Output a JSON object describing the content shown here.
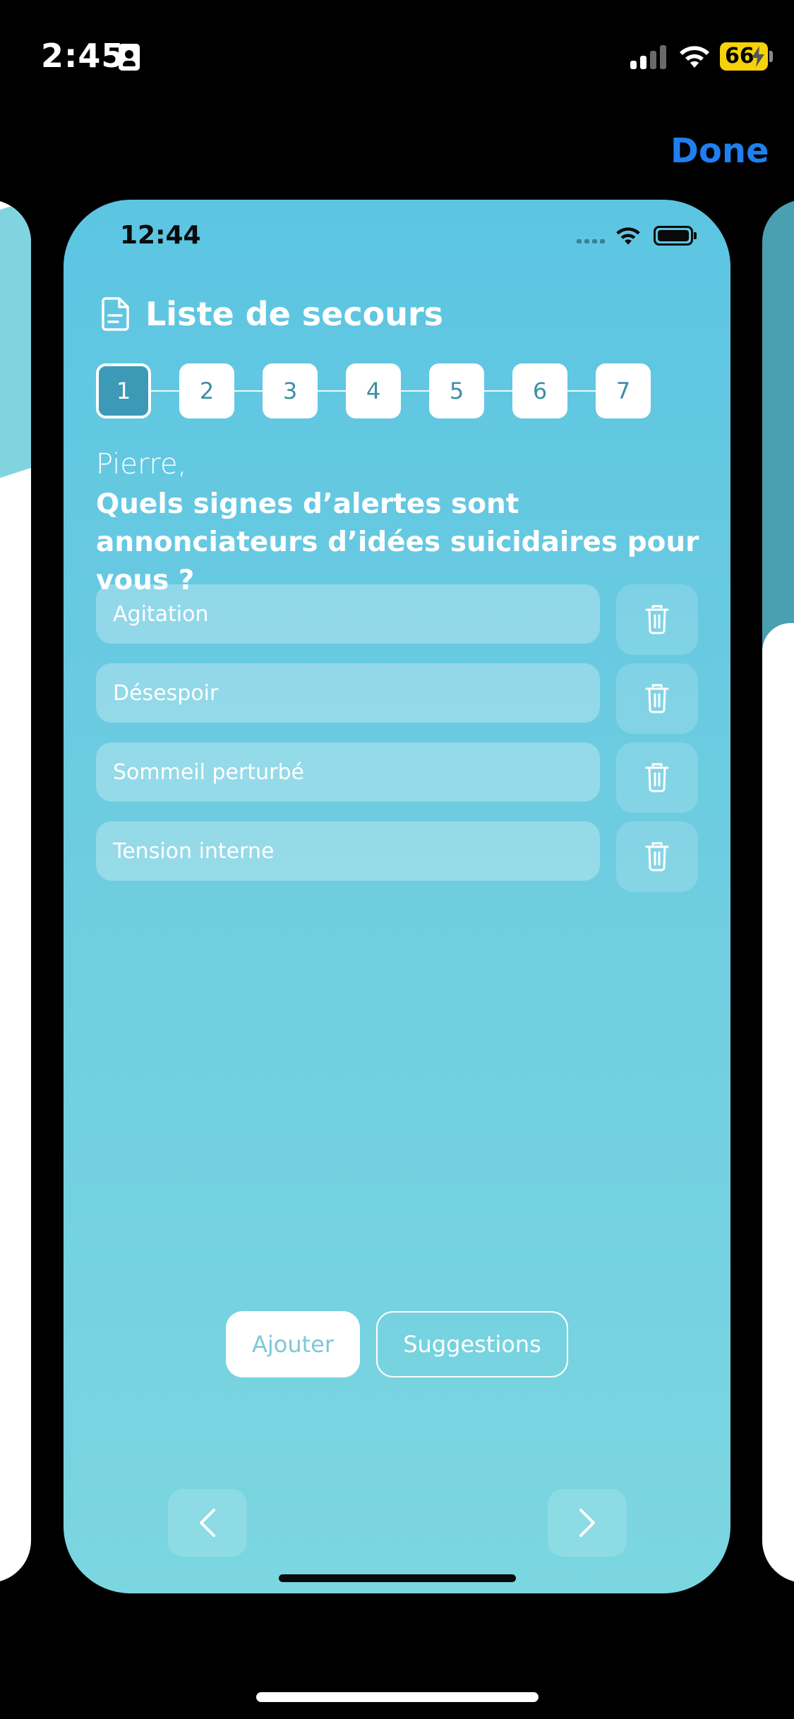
{
  "device_status": {
    "time": "2:45",
    "battery_level": "66",
    "battery_color": "#f6d20a"
  },
  "header": {
    "done_label": "Done",
    "done_color": "#1f7ff0"
  },
  "preview": {
    "status_time": "12:44",
    "title": "Liste de secours",
    "steps": [
      "1",
      "2",
      "3",
      "4",
      "5",
      "6",
      "7"
    ],
    "active_step": "1",
    "greeting": "Pierre,",
    "question": "Quels signes d’alertes sont annonciateurs d’idées suicidaires pour vous ?",
    "items": [
      {
        "label": "Agitation"
      },
      {
        "label": "Désespoir"
      },
      {
        "label": "Sommeil perturbé"
      },
      {
        "label": "Tension interne"
      }
    ],
    "add_label": "Ajouter",
    "suggestions_label": "Suggestions",
    "accent_color": "#3d9ab7"
  }
}
